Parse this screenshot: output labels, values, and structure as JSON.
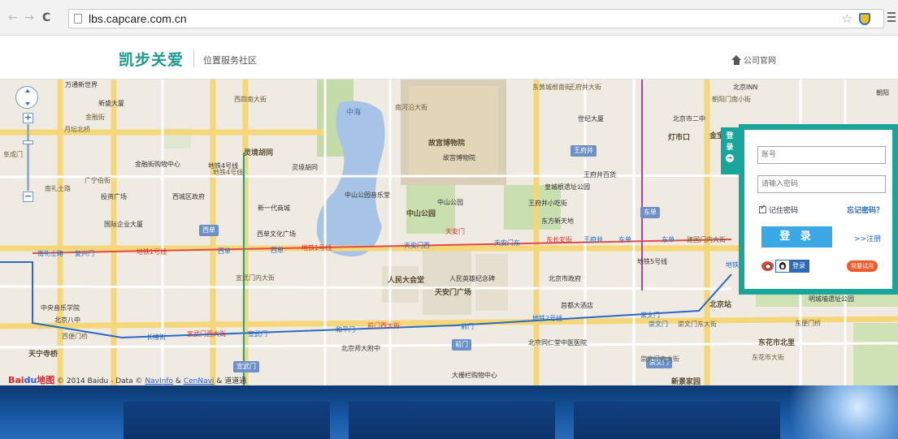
{
  "browser": {
    "back": "←",
    "forward": "→",
    "reload": "C",
    "url": "lbs.capcare.com.cn",
    "star": "☆"
  },
  "header": {
    "brand": "凯步关爱",
    "subtitle": "位置服务社区",
    "home_link": "公司官网"
  },
  "map": {
    "labels_big": {
      "palace": "故宫博物院",
      "zhongshan_park": "中山公园",
      "great_hall": "人民大会堂",
      "tiananmen_sq": "天安门广场",
      "beijing_station": "北京站",
      "dongcheng_north": "东花市北里",
      "xinjing": "新景家园",
      "tiantan": "天宁寺桥"
    },
    "labels": {
      "zhonghai": "中海",
      "wantong": "万通新世界",
      "xinsheng": "新盛大厦",
      "yuetan": "月坛北桥",
      "jinrongjie": "金融街购物中心",
      "lingjing": "灵境胡同",
      "lingjing2": "灵境胡同",
      "guangningbo": "广宁伯街",
      "touzi": "投资广场",
      "xicheng_gov": "西城区政府",
      "xindai": "新一代商城",
      "guoji": "国际企业大厦",
      "xidan_wenhua": "西单文化广场",
      "park_music": "中山公园音乐堂",
      "zhongshan2": "中山公园",
      "tiananmen": "天安门",
      "palace2": "故宫博物院",
      "wangfujing_bh": "王府井百货",
      "huangcheng": "皇城根遗址公园",
      "xiaochi": "王府井小吃街",
      "dongfang": "东方新天地",
      "shiji": "世纪大厦",
      "er_zhong": "北京市二中",
      "dengshikou": "灯市口",
      "beijing_inn": "北京INN",
      "chaoyang": "朝阳",
      "yingxiong": "人民英雄纪念碑",
      "beijing_gov": "北京市政府",
      "shoudu_hotel": "首都大酒店",
      "mingcheng": "明城墙遗址公园",
      "zhongyang_yyy": "中央音乐学院",
      "beijing_8": "北京八中",
      "shifan": "北京师大附中",
      "tongren": "北京同仁堂中医医院",
      "dashilan": "大栅栏购物中心",
      "dongbianmen": "东便门桥",
      "xibianmen": "西便门桥",
      "tianning": "天宁寺桥",
      "hong_fu": "东花市大街",
      "chongwenmen_dajie": "崇文门东大街",
      "jianguomen": "建国门内大街",
      "jinbaojie": "金宝",
      "xidan_badge": "西单",
      "wangfujing_badge": "王府井",
      "dongdan_badge": "东单",
      "xuanwumen_badge": "宣武门",
      "qianmen_badge": "前门",
      "chongwenmen_badge": "崇文门"
    },
    "stations": {
      "nanlishilu": "南礼士路",
      "fuxingmen": "复兴门",
      "xidan": "西单",
      "xidan2": "西单",
      "tiananmen_w": "天安门西",
      "tiananmen_e": "天安门东",
      "wangfujing": "王府井",
      "dongdan": "东单",
      "dongdan2": "东单",
      "changchunjie": "长椿街",
      "xuanwumen": "宣武门",
      "hepingmen": "和平门",
      "qianmen": "前门",
      "chongwenmen": "崇文门",
      "chongwenmen2": "崇文门"
    },
    "line_labels": {
      "line1_w": "地铁1号线",
      "line1": "地铁1号线",
      "line2": "地铁2号线",
      "line2_e": "地铁2号线",
      "line4": "地铁4号线",
      "line5": "地铁5号线",
      "changan_w": "宣武门西大街",
      "qianmen_xi": "前门西大街",
      "changan_e": "东长安街"
    },
    "roads": {
      "fuchengmen": "阜成门",
      "xisi": "西四南大街",
      "xuanwu": "宣武门内大街",
      "dongjie": "东黄城根南街",
      "wangfujing_st": "王府井大街",
      "chaoyangmen": "朝阳门南小街",
      "nanheyan": "南河沿大街",
      "jinshi": "金融街",
      "nanlishi": "南礼士路",
      "chongwenmen_st": "崇文门内大街",
      "ditie_4": "地铁4号线"
    },
    "copyright": "© 2014 Baidu - Data ©",
    "navinfo": "NavInfo",
    "amp": "&",
    "cennavi": "CenNavi",
    "daodao": "& 道道通",
    "baidu_logo": "Bai",
    "baidu_logo2": "du",
    "baidu_logo3": "地图"
  },
  "login": {
    "tab_line1": "登",
    "tab_line2": "录",
    "tab_arrow": "➜",
    "username_placeholder": "账号",
    "password_placeholder": "请输入密码",
    "remember": "记住密码",
    "forgot": "忘记密码？",
    "login_button": "登 录",
    "register": ">>注册",
    "qq_login": "登录",
    "trial": "我要试用"
  },
  "colors": {
    "brand": "#1e9a8e",
    "panel": "#1aa59b",
    "button": "#3aa8e4",
    "metro_blue": "#2a6ac0",
    "road_yellow": "#f5d77a",
    "subway_red": "#e24a4a"
  }
}
